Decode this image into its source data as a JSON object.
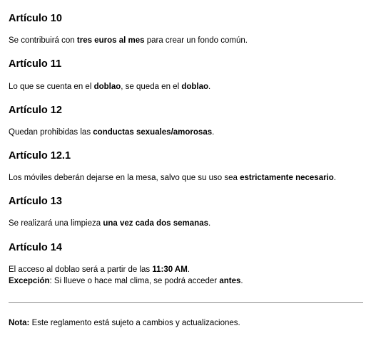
{
  "articles": [
    {
      "title": "Artículo 10",
      "text": {
        "a": "Se contribuirá con ",
        "b": "tres euros al mes",
        "c": " para crear un fondo común."
      }
    },
    {
      "title": "Artículo 11",
      "text": {
        "a": "Lo que se cuenta en el ",
        "b": "doblao",
        "c": ", se queda en el ",
        "d": "doblao",
        "e": "."
      }
    },
    {
      "title": "Artículo 12",
      "text": {
        "a": "Quedan prohibidas las ",
        "b": "conductas sexuales/amorosas",
        "c": "."
      }
    },
    {
      "title": "Artículo 12.1",
      "text": {
        "a": "Los móviles deberán dejarse en la mesa, salvo que su uso sea ",
        "b": "estrictamente necesario",
        "c": "."
      }
    },
    {
      "title": "Artículo 13",
      "text": {
        "a": "Se realizará una limpieza ",
        "b": "una vez cada dos semanas",
        "c": "."
      }
    },
    {
      "title": "Artículo 14",
      "line1": {
        "a": "El acceso al doblao será a partir de las ",
        "b": "11:30 AM",
        "c": "."
      },
      "line2": {
        "a": "Excepción",
        "b": ": Si llueve o hace mal clima, se podrá acceder ",
        "c": "antes",
        "d": "."
      }
    }
  ],
  "note": {
    "label": "Nota:",
    "text": " Este reglamento está sujeto a cambios y actualizaciones."
  }
}
